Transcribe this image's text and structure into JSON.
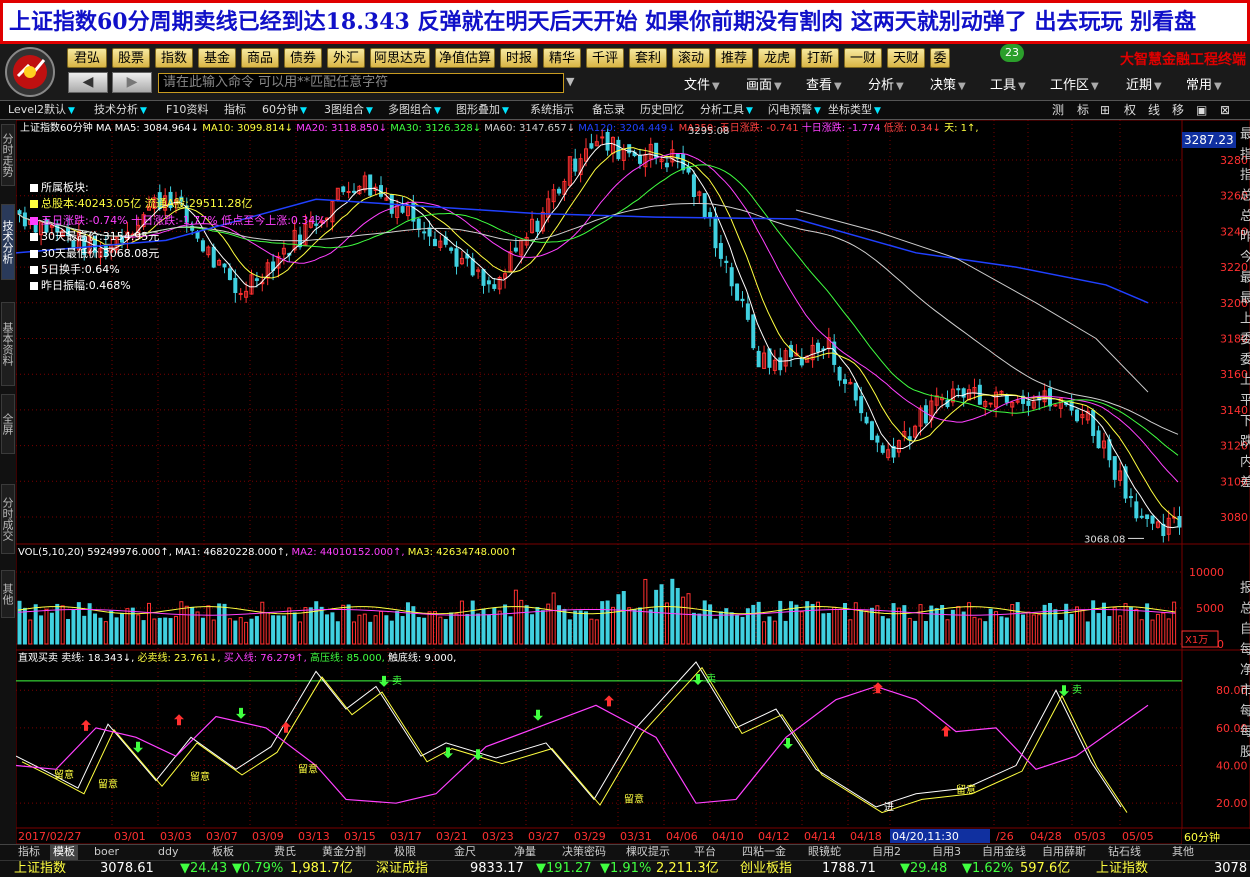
{
  "banner": "上证指数60分周期卖线已经到达18.343 反弹就在明天后天开始 如果你前期没有割肉 这两天就别动弹了 出去玩玩 别看盘",
  "brand": "大智慧金融工程终端",
  "badge": "23",
  "quick_buttons": [
    "君弘",
    "股票",
    "指数",
    "基金",
    "商品",
    "债券",
    "外汇",
    "阿思达克",
    "净值估算",
    "时报",
    "精华",
    "千评",
    "套利",
    "滚动",
    "推荐",
    "龙虎",
    "打新",
    "一财",
    "天财",
    "委"
  ],
  "nav": {
    "back": "◀",
    "forward": "▶"
  },
  "command": {
    "placeholder": "请在此输入命令  可以用**匹配任意字符"
  },
  "menus": [
    "文件",
    "画面",
    "查看",
    "分析",
    "决策",
    "工具",
    "工作区",
    "近期",
    "常用"
  ],
  "toolbar": [
    "Level2默认",
    "技术分析",
    "F10资料",
    "指标",
    "60分钟",
    "3图组合",
    "多图组合",
    "图形叠加",
    "系统指示",
    "备忘录",
    "历史回忆",
    "分析工具",
    "闪电预警",
    "坐标类型"
  ],
  "right_tools": [
    "测",
    "标",
    "⊞",
    "权",
    "线",
    "移",
    "▣",
    "⊠"
  ],
  "left_tabs": [
    "分时走势",
    "技术分析",
    "基本资料",
    "全屏",
    "分时成交",
    "其他"
  ],
  "ma_line": {
    "prefix": "上证指数60分钟 MA",
    "items": [
      {
        "t": "MA5: 3084.964↓",
        "c": "#ffffff"
      },
      {
        "t": "MA10: 3099.814↓",
        "c": "#ffff40"
      },
      {
        "t": "MA20: 3118.850↓",
        "c": "#ff40ff"
      },
      {
        "t": "MA30: 3126.328↓",
        "c": "#40ff40"
      },
      {
        "t": "MA60: 3147.657↓",
        "c": "#d0d0d0"
      },
      {
        "t": "MA120: 3204.449↓",
        "c": "#2040ff"
      },
      {
        "t": "MA250:",
        "c": "#ff4040"
      },
      {
        "t": "五日涨跌: -0.741",
        "c": "#ff4040"
      },
      {
        "t": "十日涨跌: -1.774",
        "c": "#ff40ff"
      },
      {
        "t": "低涨: 0.34↓",
        "c": "#ff4040"
      },
      {
        "t": "天: 1↑,",
        "c": "#ffff40"
      }
    ]
  },
  "legend": {
    "items": [
      {
        "t": "所属板块:",
        "c": "#ffffff"
      },
      {
        "t": "总股本:40243.05亿  流通A股:29511.28亿",
        "c": "#ffff40"
      },
      {
        "t": "五日涨跌:-0.74%   十日涨跌:-1.77%  低点至今上涨:0.34%",
        "c": "#ff40ff"
      },
      {
        "t": "30天最高价:3154.95元",
        "c": "#ffffff"
      },
      {
        "t": "30天最低价:3068.08元",
        "c": "#ffffff"
      },
      {
        "t": "5日换手:0.64%",
        "c": "#ffffff"
      },
      {
        "t": "昨日振幅:0.468%",
        "c": "#ffffff"
      }
    ]
  },
  "price_axis": {
    "last": "3287.23",
    "ticks": [
      "3280",
      "3260",
      "3240",
      "3220",
      "3200",
      "3180",
      "3160",
      "3140",
      "3120",
      "3100",
      "3080"
    ]
  },
  "annotations": {
    "high": "3295.08",
    "low": "3068.08"
  },
  "vol_line": {
    "items": [
      {
        "t": "VOL(5,10,20) 59249976.000↑,",
        "c": "#ffffff"
      },
      {
        "t": "MA1: 46820228.000↑,",
        "c": "#ffffff"
      },
      {
        "t": "MA2: 44010152.000↑,",
        "c": "#ff40ff"
      },
      {
        "t": "MA3: 42634748.000↑",
        "c": "#ffff40"
      }
    ]
  },
  "vol_axis": {
    "ticks": [
      "10000",
      "5000",
      "0"
    ],
    "unit": "X1万"
  },
  "ind_line": {
    "items": [
      {
        "t": "直观买卖",
        "c": "#ffffff"
      },
      {
        "t": "卖线: 18.343↓,",
        "c": "#ffffff"
      },
      {
        "t": "必卖线: 23.761↓,",
        "c": "#ffff40"
      },
      {
        "t": "买入线: 76.279↑,",
        "c": "#ff40ff"
      },
      {
        "t": "高压线: 85.000,",
        "c": "#40ff40"
      },
      {
        "t": "触底线: 9.000,",
        "c": "#ffffff"
      }
    ]
  },
  "ind_axis": {
    "ticks": [
      "80.00",
      "60.00",
      "40.00",
      "20.00"
    ]
  },
  "signals": {
    "sell": "卖",
    "attention": "留意",
    "enter": "进"
  },
  "dates": [
    "2017/02/27",
    "03/01",
    "03/03",
    "03/07",
    "03/09",
    "03/13",
    "03/15",
    "03/17",
    "03/21",
    "03/23",
    "03/27",
    "03/29",
    "03/31",
    "04/06",
    "04/10",
    "04/12",
    "04/14",
    "04/18",
    "04/20,11:30",
    "/26",
    "04/28",
    "05/03",
    "05/05"
  ],
  "period": "60分钟",
  "right_edge": [
    "最",
    "指",
    "指",
    "总",
    "总",
    "昨",
    "今",
    "最",
    "最",
    "上",
    "委",
    "委",
    "上",
    "平",
    "下",
    "跌",
    "内",
    "差"
  ],
  "right_edge2": [
    "报",
    "总",
    "自",
    "每",
    "净",
    "市",
    "每",
    "每",
    "股"
  ],
  "bottom_tabs": [
    "指标",
    "模板",
    "boer",
    "ddy",
    "板板",
    "费氏",
    "黄金分割",
    "极限",
    "金尺",
    "净量",
    "决策密码",
    "棵叹提示",
    "平台",
    "四粘一金",
    "眼镜蛇",
    "自用2",
    "自用3",
    "自用金线",
    "自用薛斯",
    "钻石线",
    "其他"
  ],
  "ticker": [
    {
      "t": "上证指数",
      "c": "#ffff40"
    },
    {
      "t": "3078.61",
      "c": "#ffffff"
    },
    {
      "t": "▼24.43",
      "c": "#40ff40"
    },
    {
      "t": "▼0.79%",
      "c": "#40ff40"
    },
    {
      "t": "1,981.7亿",
      "c": "#ffff40"
    },
    {
      "t": "深证成指",
      "c": "#ffff40"
    },
    {
      "t": "9833.17",
      "c": "#ffffff"
    },
    {
      "t": "▼191.27",
      "c": "#40ff40"
    },
    {
      "t": "▼1.91%",
      "c": "#40ff40"
    },
    {
      "t": "2,211.3亿",
      "c": "#ffff40"
    },
    {
      "t": "创业板指",
      "c": "#ffff40"
    },
    {
      "t": "1788.71",
      "c": "#ffffff"
    },
    {
      "t": "▼29.48",
      "c": "#40ff40"
    },
    {
      "t": "▼1.62%",
      "c": "#40ff40"
    },
    {
      "t": "597.6亿",
      "c": "#ffff40"
    },
    {
      "t": "上证指数",
      "c": "#ffff40"
    },
    {
      "t": "3078",
      "c": "#ffffff"
    }
  ],
  "colors": {
    "up": "#ff3030",
    "down": "#40d0e0",
    "ma5": "#ffffff",
    "ma10": "#ffff40",
    "ma20": "#ff40ff",
    "ma30": "#40ff40",
    "ma60": "#d0d0d0",
    "ma120": "#2040ff",
    "grid": "#7a0000"
  }
}
